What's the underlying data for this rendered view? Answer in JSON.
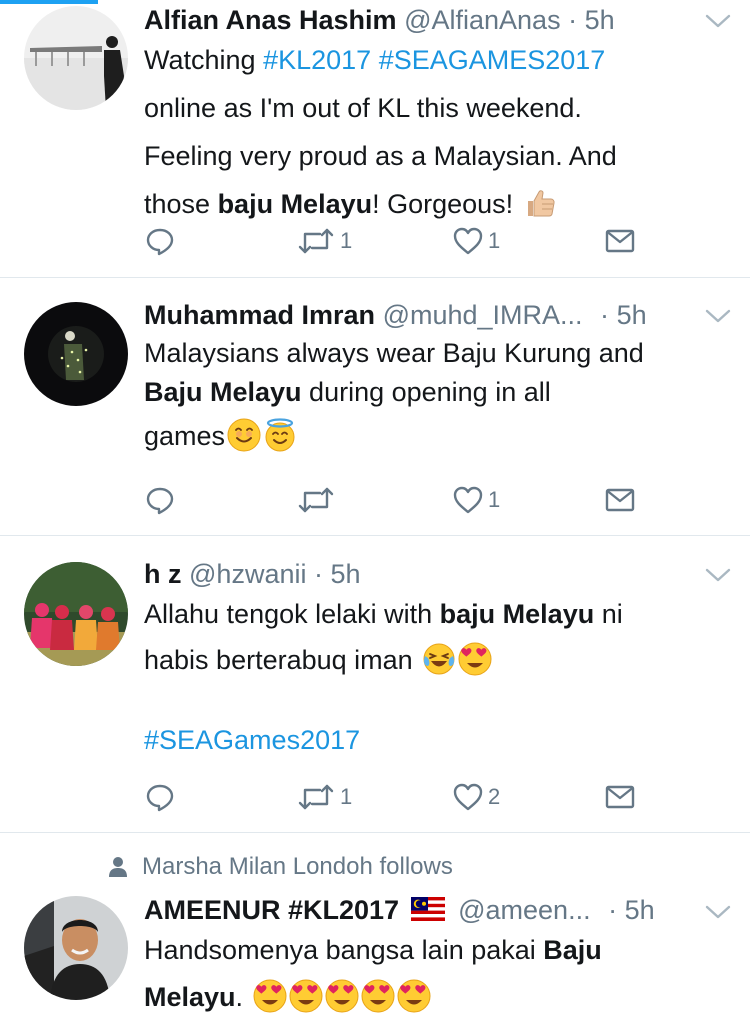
{
  "progress": 0.13,
  "colors": {
    "accent": "#1da1f2",
    "link": "#1b95e0",
    "text": "#14171a",
    "muted": "#657786",
    "divider": "#e1e8ed"
  },
  "tweets": [
    {
      "name": "Alfian Anas Hashim",
      "handle": "@AlfianAnas",
      "dot": "·",
      "time": "5h",
      "text": {
        "l1a": "Watching ",
        "l1b": "#KL2017",
        "l1c": " ",
        "l1d": "#SEAGAMES2017",
        "l2": "online as I'm out of KL this weekend.",
        "l3": "Feeling very proud as a Malaysian. And",
        "l4a": "those ",
        "l4b": "baju Melayu",
        "l4c": "! Gorgeous!"
      },
      "emoji": [
        "thumbs-up-emoji"
      ],
      "reply_icon": "reply-icon",
      "retweet_count": "1",
      "like_count": "1"
    },
    {
      "name": "Muhammad Imran",
      "handle": "@muhd_IMRA...",
      "dot": "·",
      "time": "5h",
      "text": {
        "l1": "Malaysians always wear Baju Kurung and",
        "l2a": "Baju Melayu",
        "l2b": " during opening in all",
        "l3": "games"
      },
      "emoji": [
        "smiling-face-emoji",
        "halo-face-emoji"
      ],
      "retweet_count": "",
      "like_count": "1"
    },
    {
      "name": "h z",
      "handle": "@hzwanii",
      "dot": "·",
      "time": "5h",
      "text": {
        "l1a": "Allahu tengok lelaki with ",
        "l1b": "baju Melayu",
        "l1c": " ni",
        "l2": "habis berterabuq iman",
        "l3": "#SEAGames2017"
      },
      "emoji": [
        "tears-of-joy-emoji",
        "heart-eyes-emoji"
      ],
      "retweet_count": "1",
      "like_count": "2"
    },
    {
      "social_context": "Marsha Milan Londoh follows",
      "name": "AMEENUR #KL2017",
      "handle": "@ameen...",
      "dot": "·",
      "time": "5h",
      "text": {
        "l1a": "Handsomenya bangsa lain pakai ",
        "l1b": "Baju",
        "l2a": "Melayu",
        "l2b": "."
      },
      "emoji": [
        "heart-eyes-emoji",
        "heart-eyes-emoji",
        "heart-eyes-emoji",
        "heart-eyes-emoji",
        "heart-eyes-emoji"
      ]
    }
  ]
}
